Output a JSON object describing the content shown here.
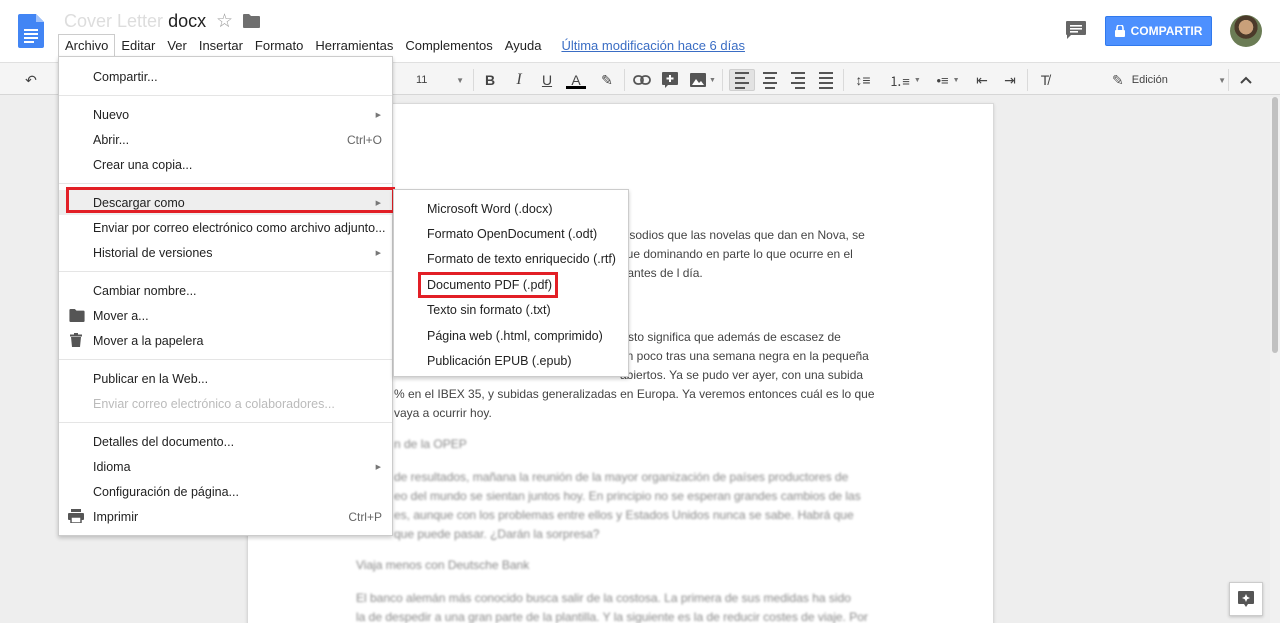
{
  "header": {
    "title_faded": "Cover Letter",
    "title_ext": "docx",
    "share_label": "COMPARTIR",
    "last_modified": "Última modificación hace 6 días"
  },
  "menubar": [
    "Archivo",
    "Editar",
    "Ver",
    "Insertar",
    "Formato",
    "Herramientas",
    "Complementos",
    "Ayuda"
  ],
  "toolbar": {
    "font_size": "11",
    "bold": "B",
    "italic": "I",
    "underline": "U",
    "text_color": "A",
    "mode": "Edición"
  },
  "file_menu": {
    "share": "Compartir...",
    "new": "Nuevo",
    "open": "Abrir...",
    "open_shortcut": "Ctrl+O",
    "copy": "Crear una copia...",
    "download": "Descargar como",
    "email": "Enviar por correo electrónico como archivo adjunto...",
    "history": "Historial de versiones",
    "rename": "Cambiar nombre...",
    "move": "Mover a...",
    "trash": "Mover a la papelera",
    "publish": "Publicar en la Web...",
    "email_collab": "Enviar correo electrónico a colaboradores...",
    "details": "Detalles del documento...",
    "language": "Idioma",
    "page_setup": "Configuración de página...",
    "print": "Imprimir",
    "print_shortcut": "Ctrl+P"
  },
  "download_menu": {
    "docx": "Microsoft Word (.docx)",
    "odt": "Formato OpenDocument (.odt)",
    "rtf": "Formato de texto enriquecido (.rtf)",
    "pdf": "Documento PDF (.pdf)",
    "txt": "Texto sin formato (.txt)",
    "html": "Página web (.html, comprimido)",
    "epub": "Publicación EPUB (.epub)"
  },
  "document": {
    "line1": "pisodios que las novelas que dan en Nova, se",
    "line2": "gue dominando en parte lo que ocurre en el",
    "line3": "rtantes de l día.",
    "line4": "Esto significa que además de escasez de",
    "line5": "un poco tras una semana negra en la pequeña",
    "line6": "abiertos. Ya se pudo ver ayer, con una subida",
    "line7": "% en el IBEX 35, y subidas generalizadas en Europa. Ya veremos entonces cuál es lo que",
    "line8": "vaya a ocurrir hoy.",
    "line9": "n de la OPEP",
    "line10": "de resultados, mañana la reunión de la mayor organización de países productores de",
    "line11": "eo del mundo se sientan juntos hoy. En principio no se esperan grandes cambios de las",
    "line12": "es, aunque con los problemas entre ellos y Estados Unidos nunca se sabe. Habrá que",
    "line13": "que puede pasar. ¿Darán la sorpresa?",
    "line14": "Viaja menos con Deutsche Bank",
    "line15": "El banco alemán más conocido busca salir de la costosa. La primera de sus medidas ha sido",
    "line16": "la de despedir a una gran parte de la plantilla. Y la siguiente es la de reducir costes de viaje. Por"
  }
}
